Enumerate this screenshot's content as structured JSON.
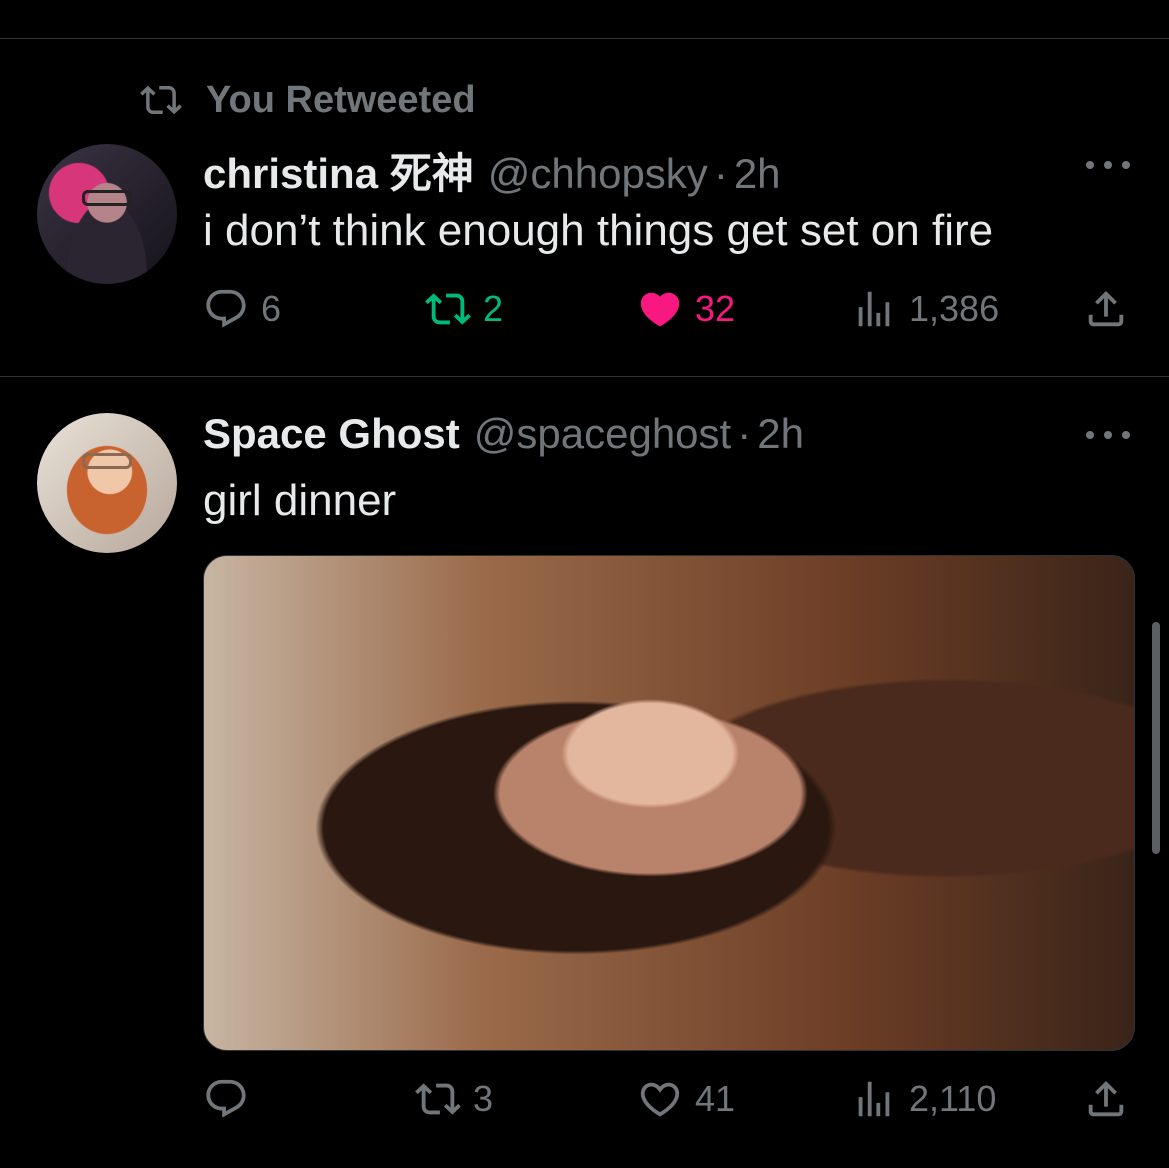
{
  "retweet_banner": {
    "label": "You Retweeted",
    "icon": "retweet-icon"
  },
  "tweets": [
    {
      "name": "christina 死神",
      "handle": "@chhopsky",
      "separator": "·",
      "time": "2h",
      "text": "i don’t think enough things get set on fire",
      "actions": {
        "replies": "6",
        "retweets": "2",
        "likes": "32",
        "views": "1,386"
      },
      "retweeted_by_you": true,
      "liked_by_you": true
    },
    {
      "name": "Space Ghost",
      "handle": "@spaceghost",
      "separator": "·",
      "time": "2h",
      "text": "girl dinner",
      "actions": {
        "replies": "",
        "retweets": "3",
        "likes": "41",
        "views": "2,110"
      },
      "retweeted_by_you": false,
      "liked_by_you": false
    }
  ],
  "colors": {
    "background": "#000000",
    "text": "#e7e9ea",
    "muted": "#71767b",
    "retweet_green": "#00ba7c",
    "like_pink": "#f91880",
    "divider": "#2f3336"
  }
}
